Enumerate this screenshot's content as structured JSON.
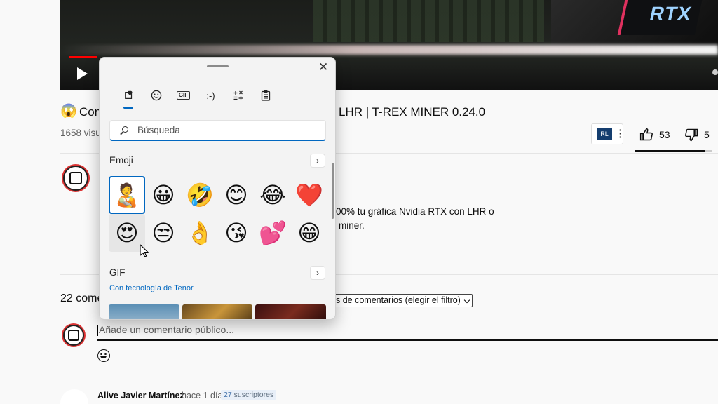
{
  "video": {
    "logo_text": "RTX"
  },
  "title": {
    "emoji": "😱",
    "left_text": "Con",
    "right_text": "LHR | T-REX MINER 0.24.0"
  },
  "views": "1658 visu",
  "actions": {
    "likes": "53",
    "dislikes": "5",
    "like_ratio": 0.91,
    "badge_text": "RL"
  },
  "description": {
    "line1": "00% tu gráfica Nvidia RTX con LHR o",
    "line2": "miner."
  },
  "comments": {
    "count_text": "22 come",
    "filter_label": "s de comentarios (elegir el filtro)",
    "input_placeholder": "Añade un comentario público...",
    "first_author": "Alive Javier Martínez",
    "first_time": "hace 1 día",
    "subscriber_count": "27",
    "subscriber_label": "suscriptores"
  },
  "emoji_panel": {
    "tabs": [
      {
        "icon": "heart-sticker-icon",
        "glyph": "❤",
        "active": true
      },
      {
        "icon": "smiley-icon",
        "glyph": "☺",
        "active": false
      },
      {
        "icon": "gif-icon",
        "glyph": "GIF",
        "active": false
      },
      {
        "icon": "kaomoji-icon",
        "glyph": ";-)",
        "active": false
      },
      {
        "icon": "symbols-icon",
        "glyph": "Ω",
        "active": false
      },
      {
        "icon": "clipboard-icon",
        "glyph": "📋",
        "active": false
      }
    ],
    "search_placeholder": "Búsqueda",
    "emoji_section": "Emoji",
    "emojis": [
      "🧑‍🍼",
      "😀",
      "🤣",
      "😊",
      "😂",
      "❤️",
      "😍",
      "😒",
      "👌",
      "😘",
      "💕",
      "😁"
    ],
    "gif_section": "GIF",
    "tenor_text": "Con tecnología de Tenor",
    "more_glyph": "›",
    "close_glyph": "✕"
  },
  "colors": {
    "accent": "#0067c0",
    "red": "#ff0000"
  }
}
